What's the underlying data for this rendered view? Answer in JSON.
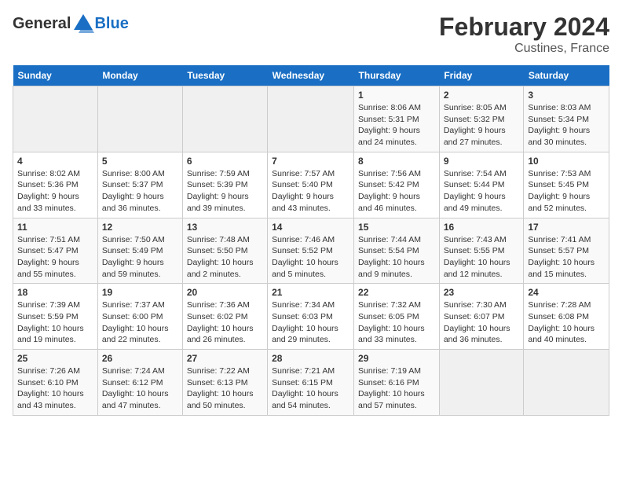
{
  "logo": {
    "general": "General",
    "blue": "Blue"
  },
  "title": "February 2024",
  "subtitle": "Custines, France",
  "days_header": [
    "Sunday",
    "Monday",
    "Tuesday",
    "Wednesday",
    "Thursday",
    "Friday",
    "Saturday"
  ],
  "weeks": [
    [
      {
        "day": "",
        "info": ""
      },
      {
        "day": "",
        "info": ""
      },
      {
        "day": "",
        "info": ""
      },
      {
        "day": "",
        "info": ""
      },
      {
        "day": "1",
        "info": "Sunrise: 8:06 AM\nSunset: 5:31 PM\nDaylight: 9 hours\nand 24 minutes."
      },
      {
        "day": "2",
        "info": "Sunrise: 8:05 AM\nSunset: 5:32 PM\nDaylight: 9 hours\nand 27 minutes."
      },
      {
        "day": "3",
        "info": "Sunrise: 8:03 AM\nSunset: 5:34 PM\nDaylight: 9 hours\nand 30 minutes."
      }
    ],
    [
      {
        "day": "4",
        "info": "Sunrise: 8:02 AM\nSunset: 5:36 PM\nDaylight: 9 hours\nand 33 minutes."
      },
      {
        "day": "5",
        "info": "Sunrise: 8:00 AM\nSunset: 5:37 PM\nDaylight: 9 hours\nand 36 minutes."
      },
      {
        "day": "6",
        "info": "Sunrise: 7:59 AM\nSunset: 5:39 PM\nDaylight: 9 hours\nand 39 minutes."
      },
      {
        "day": "7",
        "info": "Sunrise: 7:57 AM\nSunset: 5:40 PM\nDaylight: 9 hours\nand 43 minutes."
      },
      {
        "day": "8",
        "info": "Sunrise: 7:56 AM\nSunset: 5:42 PM\nDaylight: 9 hours\nand 46 minutes."
      },
      {
        "day": "9",
        "info": "Sunrise: 7:54 AM\nSunset: 5:44 PM\nDaylight: 9 hours\nand 49 minutes."
      },
      {
        "day": "10",
        "info": "Sunrise: 7:53 AM\nSunset: 5:45 PM\nDaylight: 9 hours\nand 52 minutes."
      }
    ],
    [
      {
        "day": "11",
        "info": "Sunrise: 7:51 AM\nSunset: 5:47 PM\nDaylight: 9 hours\nand 55 minutes."
      },
      {
        "day": "12",
        "info": "Sunrise: 7:50 AM\nSunset: 5:49 PM\nDaylight: 9 hours\nand 59 minutes."
      },
      {
        "day": "13",
        "info": "Sunrise: 7:48 AM\nSunset: 5:50 PM\nDaylight: 10 hours\nand 2 minutes."
      },
      {
        "day": "14",
        "info": "Sunrise: 7:46 AM\nSunset: 5:52 PM\nDaylight: 10 hours\nand 5 minutes."
      },
      {
        "day": "15",
        "info": "Sunrise: 7:44 AM\nSunset: 5:54 PM\nDaylight: 10 hours\nand 9 minutes."
      },
      {
        "day": "16",
        "info": "Sunrise: 7:43 AM\nSunset: 5:55 PM\nDaylight: 10 hours\nand 12 minutes."
      },
      {
        "day": "17",
        "info": "Sunrise: 7:41 AM\nSunset: 5:57 PM\nDaylight: 10 hours\nand 15 minutes."
      }
    ],
    [
      {
        "day": "18",
        "info": "Sunrise: 7:39 AM\nSunset: 5:59 PM\nDaylight: 10 hours\nand 19 minutes."
      },
      {
        "day": "19",
        "info": "Sunrise: 7:37 AM\nSunset: 6:00 PM\nDaylight: 10 hours\nand 22 minutes."
      },
      {
        "day": "20",
        "info": "Sunrise: 7:36 AM\nSunset: 6:02 PM\nDaylight: 10 hours\nand 26 minutes."
      },
      {
        "day": "21",
        "info": "Sunrise: 7:34 AM\nSunset: 6:03 PM\nDaylight: 10 hours\nand 29 minutes."
      },
      {
        "day": "22",
        "info": "Sunrise: 7:32 AM\nSunset: 6:05 PM\nDaylight: 10 hours\nand 33 minutes."
      },
      {
        "day": "23",
        "info": "Sunrise: 7:30 AM\nSunset: 6:07 PM\nDaylight: 10 hours\nand 36 minutes."
      },
      {
        "day": "24",
        "info": "Sunrise: 7:28 AM\nSunset: 6:08 PM\nDaylight: 10 hours\nand 40 minutes."
      }
    ],
    [
      {
        "day": "25",
        "info": "Sunrise: 7:26 AM\nSunset: 6:10 PM\nDaylight: 10 hours\nand 43 minutes."
      },
      {
        "day": "26",
        "info": "Sunrise: 7:24 AM\nSunset: 6:12 PM\nDaylight: 10 hours\nand 47 minutes."
      },
      {
        "day": "27",
        "info": "Sunrise: 7:22 AM\nSunset: 6:13 PM\nDaylight: 10 hours\nand 50 minutes."
      },
      {
        "day": "28",
        "info": "Sunrise: 7:21 AM\nSunset: 6:15 PM\nDaylight: 10 hours\nand 54 minutes."
      },
      {
        "day": "29",
        "info": "Sunrise: 7:19 AM\nSunset: 6:16 PM\nDaylight: 10 hours\nand 57 minutes."
      },
      {
        "day": "",
        "info": ""
      },
      {
        "day": "",
        "info": ""
      }
    ]
  ]
}
